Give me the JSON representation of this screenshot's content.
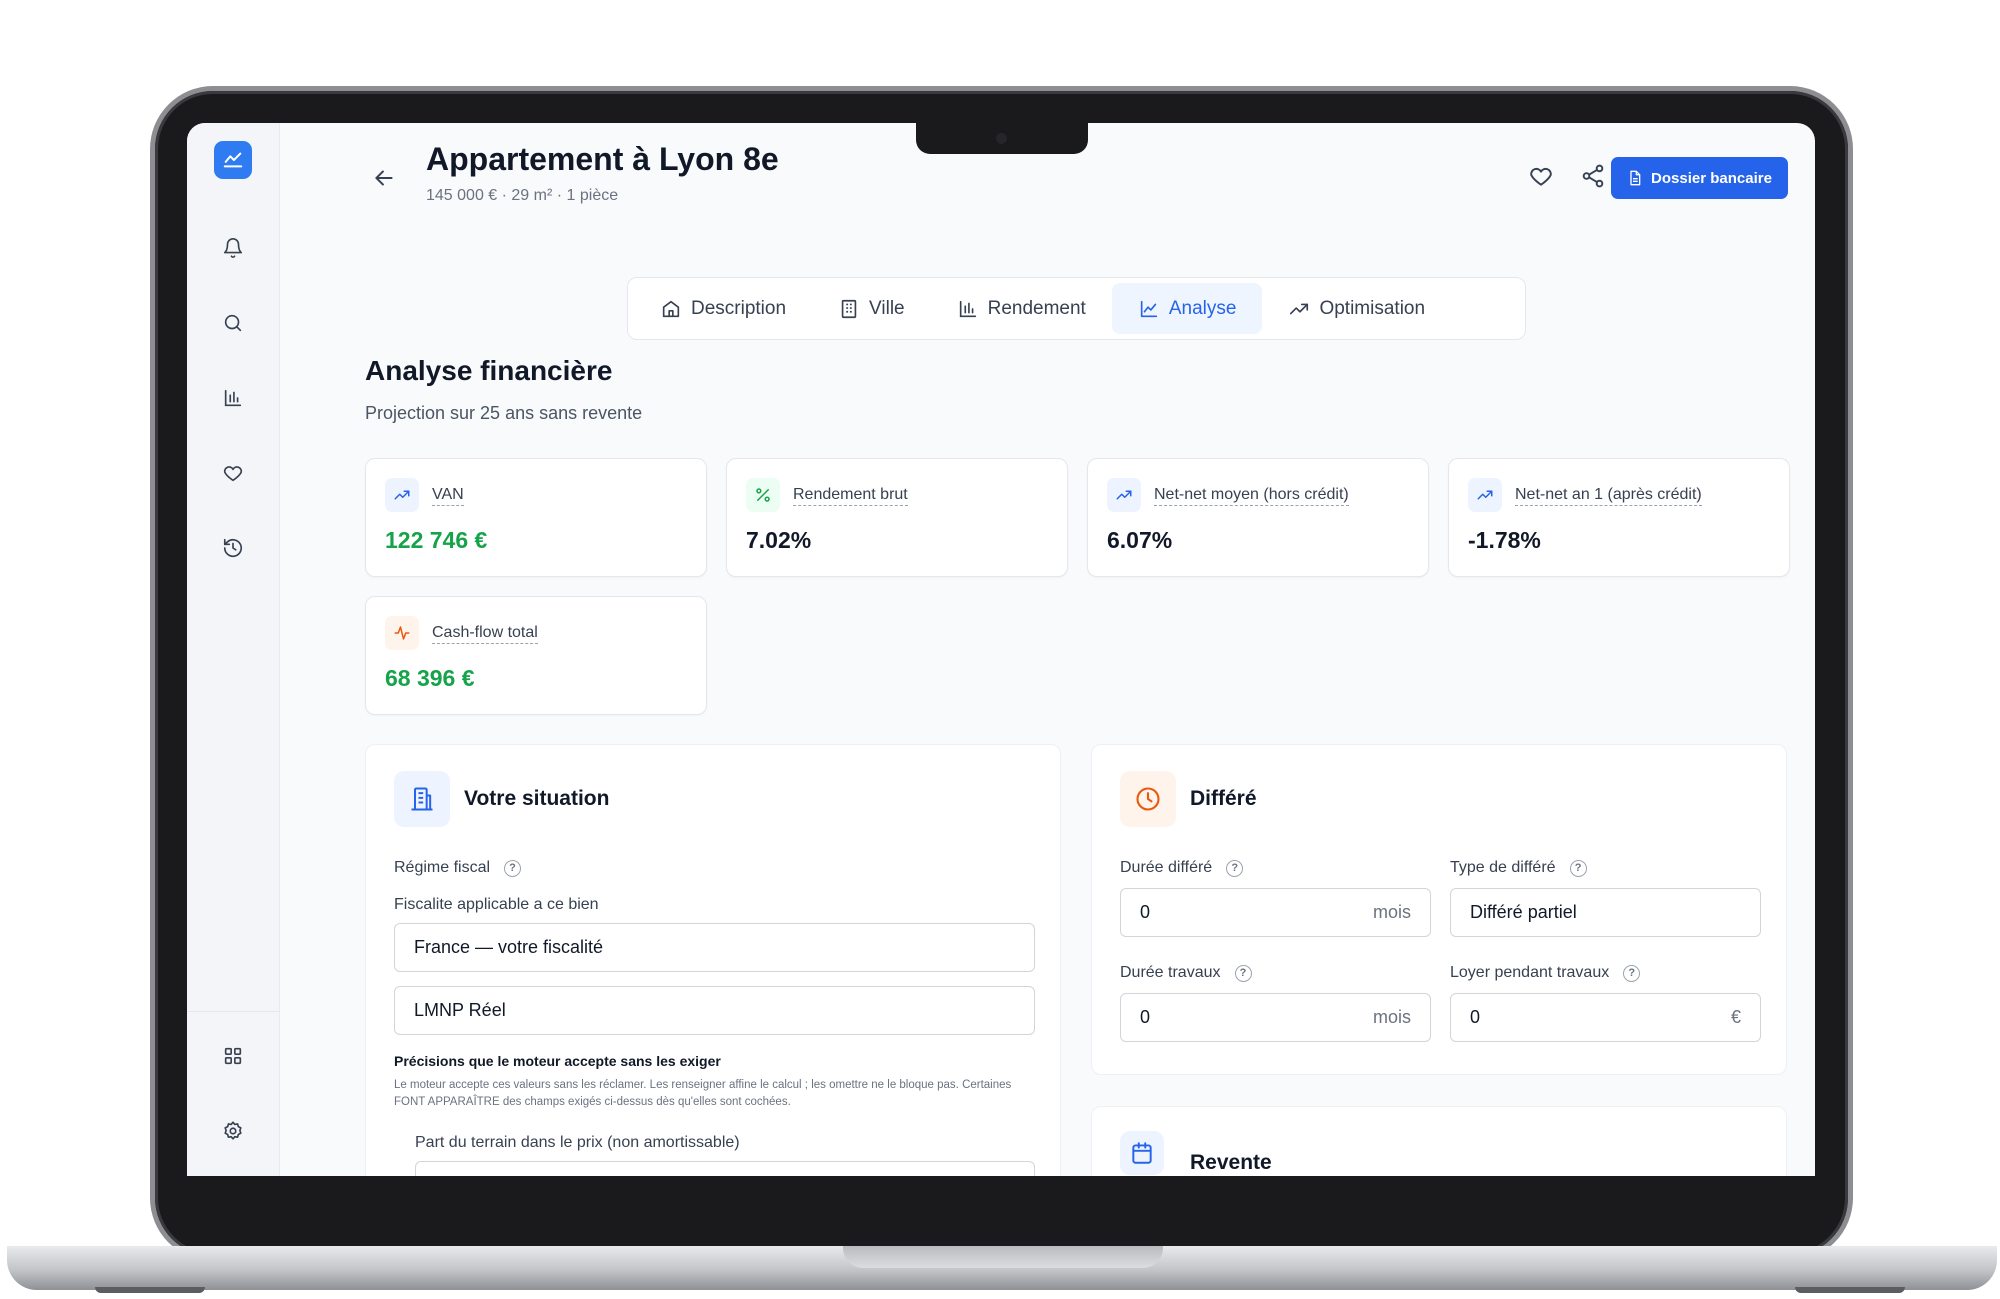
{
  "header": {
    "title": "Appartement à Lyon 8e",
    "subtitle": "145 000 € · 29 m² · 1 pièce",
    "primary_button": "Dossier bancaire"
  },
  "icons": {
    "sidebar": [
      "logo-chart-icon",
      "bell-icon",
      "search-icon",
      "bar-chart-icon",
      "heart-icon",
      "history-icon",
      "grid-icon",
      "gear-icon"
    ],
    "header": [
      "arrow-left-icon",
      "heart-icon",
      "share-icon",
      "document-icon"
    ]
  },
  "tabs": [
    {
      "label": "Description",
      "icon": "home-icon",
      "active": false
    },
    {
      "label": "Ville",
      "icon": "building-icon",
      "active": false
    },
    {
      "label": "Rendement",
      "icon": "bar-chart-icon",
      "active": false
    },
    {
      "label": "Analyse",
      "icon": "line-chart-icon",
      "active": true
    },
    {
      "label": "Optimisation",
      "icon": "trending-up-icon",
      "active": false
    }
  ],
  "section": {
    "title": "Analyse financière",
    "subtitle": "Projection sur 25 ans sans revente"
  },
  "kpis": [
    {
      "label": "VAN",
      "value": "122 746 €",
      "tone": "green"
    },
    {
      "label": "Rendement brut",
      "value": "7.02%",
      "tone": "dark"
    },
    {
      "label": "Net-net moyen (hors crédit)",
      "value": "6.07%",
      "tone": "dark"
    },
    {
      "label": "Net-net an 1 (après crédit)",
      "value": "-1.78%",
      "tone": "dark"
    },
    {
      "label": "Cash-flow total",
      "value": "68 396 €",
      "tone": "green"
    }
  ],
  "situation": {
    "title": "Votre situation",
    "regime_label": "Régime fiscal",
    "fiscalite_label": "Fiscalite applicable a ce bien",
    "country_value": "France — votre fiscalité",
    "regime_value": "LMNP Réel",
    "note_title": "Précisions que le moteur accepte sans les exiger",
    "note_text": "Le moteur accepte ces valeurs sans les réclamer. Les renseigner affine le calcul ; les omettre ne le bloque pas. Certaines FONT APPARAÎTRE des champs exigés ci-dessus dès qu'elles sont cochées.",
    "terrain_label": "Part du terrain dans le prix (non amortissable)"
  },
  "differe": {
    "title": "Différé",
    "duree_label": "Durée différé",
    "duree_value": "0",
    "duree_unit": "mois",
    "type_label": "Type de différé",
    "type_value": "Différé partiel",
    "travaux_label": "Durée travaux",
    "travaux_value": "0",
    "travaux_unit": "mois",
    "loyer_label": "Loyer pendant travaux",
    "loyer_value": "0",
    "loyer_unit": "€"
  },
  "revente": {
    "title": "Revente"
  },
  "colors": {
    "accent": "#2563eb",
    "positive": "#16a34a",
    "warning": "#ea580c"
  }
}
